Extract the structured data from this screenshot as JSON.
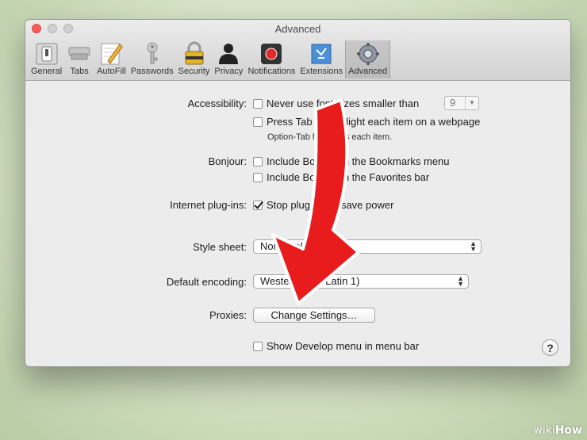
{
  "window": {
    "title": "Advanced"
  },
  "toolbar": {
    "items": [
      {
        "label": "General",
        "icon": "general-switch-icon"
      },
      {
        "label": "Tabs",
        "icon": "tabs-icon"
      },
      {
        "label": "AutoFill",
        "icon": "autofill-pencil-icon"
      },
      {
        "label": "Passwords",
        "icon": "key-icon"
      },
      {
        "label": "Security",
        "icon": "padlock-icon"
      },
      {
        "label": "Privacy",
        "icon": "silhouette-icon"
      },
      {
        "label": "Notifications",
        "icon": "notification-icon"
      },
      {
        "label": "Extensions",
        "icon": "puzzle-icon"
      },
      {
        "label": "Advanced",
        "icon": "gear-icon"
      }
    ],
    "selected": "Advanced"
  },
  "accessibility": {
    "label": "Accessibility:",
    "min_font_option": "Never use font sizes smaller than",
    "min_font_value": "9",
    "tab_option": "Press Tab to highlight each item on a webpage",
    "tab_hint": "Option-Tab highlights each item."
  },
  "bonjour": {
    "label": "Bonjour:",
    "bookmarks_option": "Include Bonjour in the Bookmarks menu",
    "favorites_option": "Include Bonjour in the Favorites bar"
  },
  "plugins": {
    "label": "Internet plug-ins:",
    "stop_option": "Stop plug-ins to save power",
    "stop_checked": true
  },
  "stylesheet": {
    "label": "Style sheet:",
    "value": "None Selected"
  },
  "encoding": {
    "label": "Default encoding:",
    "value": "Western (ISO Latin 1)"
  },
  "proxies": {
    "label": "Proxies:",
    "button": "Change Settings…"
  },
  "develop": {
    "option": "Show Develop menu in menu bar"
  },
  "help": {
    "glyph": "?"
  },
  "watermark": {
    "prefix": "wiki",
    "suffix": "How"
  },
  "colors": {
    "arrow": "#e81c1c",
    "close_button": "#fc5b57"
  }
}
